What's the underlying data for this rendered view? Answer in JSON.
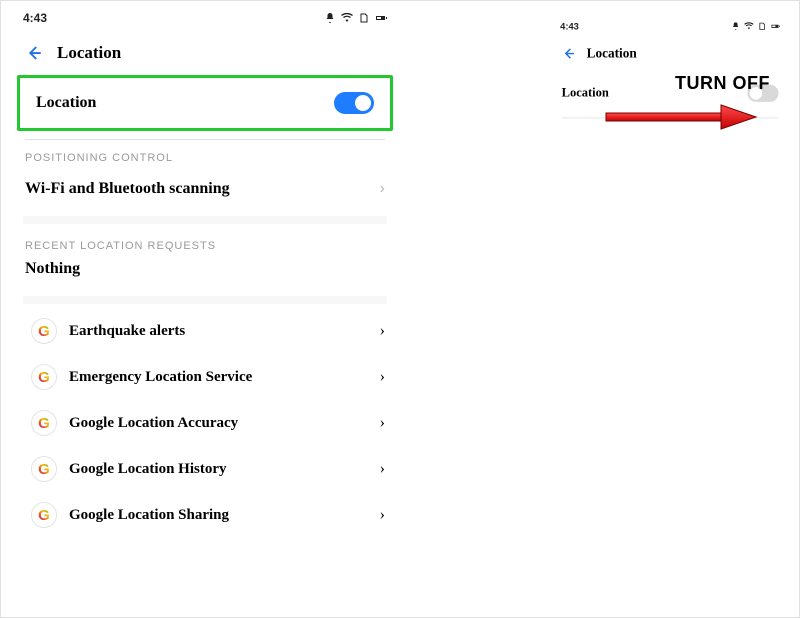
{
  "status": {
    "time": "4:43"
  },
  "header": {
    "title": "Location"
  },
  "toggle_row": {
    "label": "Location"
  },
  "sections": {
    "positioning_control": {
      "label": "POSITIONING CONTROL",
      "item": "Wi-Fi and Bluetooth scanning"
    },
    "recent_requests": {
      "label": "RECENT LOCATION REQUESTS",
      "nothing": "Nothing"
    }
  },
  "google_items": [
    {
      "label": "Earthquake alerts"
    },
    {
      "label": "Emergency Location Service"
    },
    {
      "label": "Google Location Accuracy"
    },
    {
      "label": "Google Location History"
    },
    {
      "label": "Google Location Sharing"
    }
  ],
  "annotation": {
    "turn_off": "TURN OFF"
  }
}
